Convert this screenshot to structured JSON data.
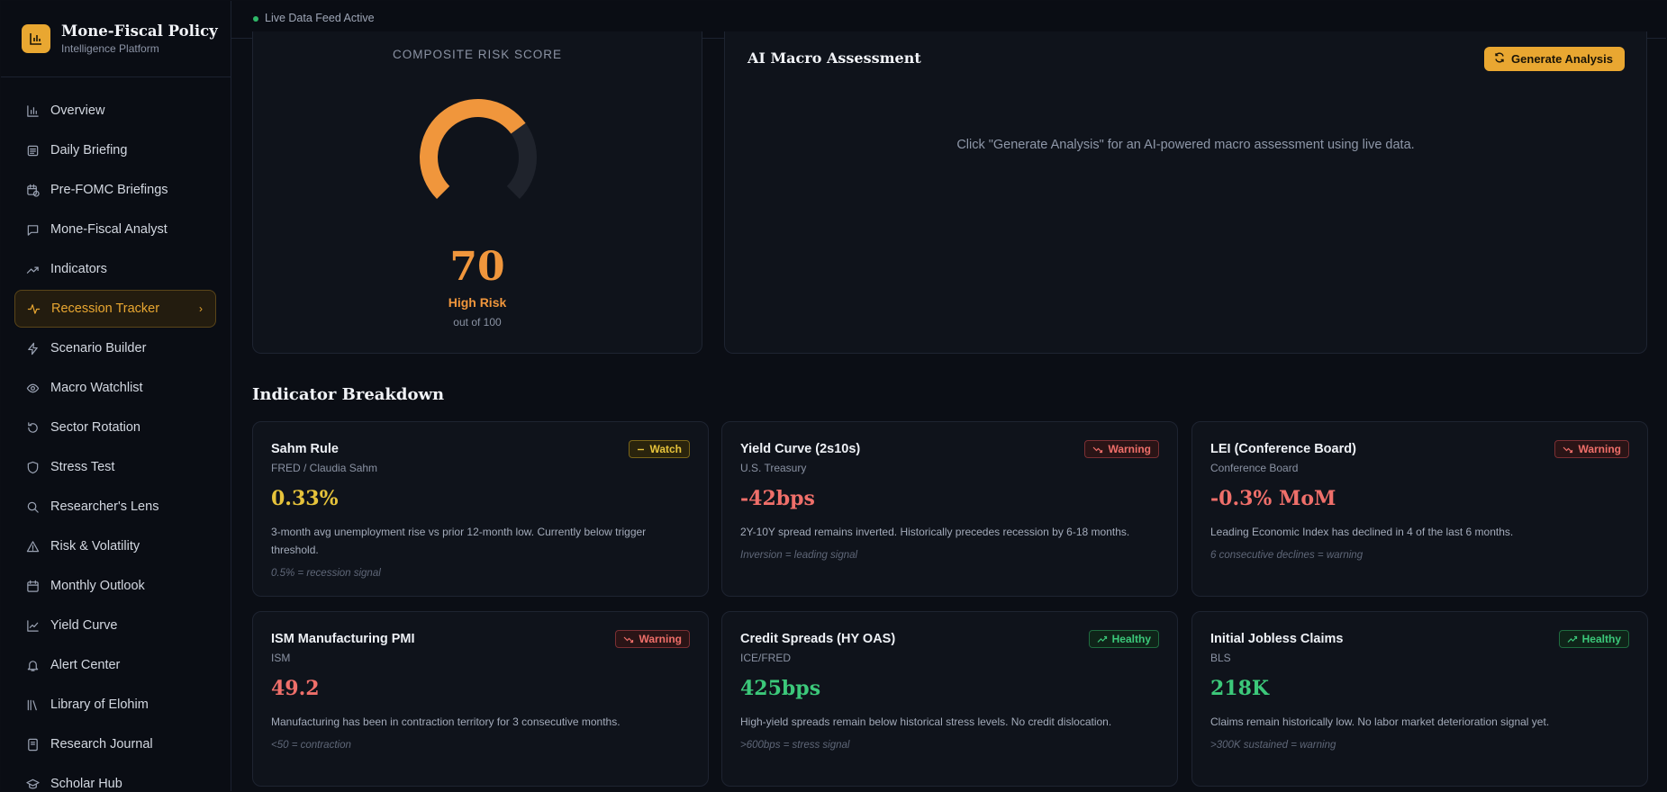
{
  "brand": {
    "title": "Mone-Fiscal Policy",
    "subtitle": "Intelligence Platform",
    "accent": "#e9a731"
  },
  "status": {
    "live_text": "Live Data Feed Active",
    "color": "#2fb868"
  },
  "sidebar": {
    "items": [
      {
        "label": "Overview",
        "icon": "bar-chart-icon"
      },
      {
        "label": "Daily Briefing",
        "icon": "newspaper-icon"
      },
      {
        "label": "Pre-FOMC Briefings",
        "icon": "calendar-clock-icon"
      },
      {
        "label": "Mone-Fiscal Analyst",
        "icon": "chat-icon"
      },
      {
        "label": "Indicators",
        "icon": "trending-up-icon"
      },
      {
        "label": "Recession Tracker",
        "icon": "activity-icon",
        "active": true
      },
      {
        "label": "Scenario Builder",
        "icon": "zap-icon"
      },
      {
        "label": "Macro Watchlist",
        "icon": "eye-icon"
      },
      {
        "label": "Sector Rotation",
        "icon": "rotate-icon"
      },
      {
        "label": "Stress Test",
        "icon": "shield-icon"
      },
      {
        "label": "Researcher's Lens",
        "icon": "search-icon"
      },
      {
        "label": "Risk & Volatility",
        "icon": "alert-triangle-icon"
      },
      {
        "label": "Monthly Outlook",
        "icon": "calendar-icon"
      },
      {
        "label": "Yield Curve",
        "icon": "line-chart-icon"
      },
      {
        "label": "Alert Center",
        "icon": "bell-icon"
      },
      {
        "label": "Library of Elohim",
        "icon": "library-icon"
      },
      {
        "label": "Research Journal",
        "icon": "notebook-icon"
      },
      {
        "label": "Scholar Hub",
        "icon": "graduation-cap-icon"
      }
    ]
  },
  "risk": {
    "label": "COMPOSITE RISK SCORE",
    "score": "70",
    "score_value": 70,
    "max": 100,
    "level": "High Risk",
    "out_of": "out of 100",
    "color": "#f0963c"
  },
  "ai": {
    "title": "AI Macro Assessment",
    "button_label": "Generate Analysis",
    "message": "Click \"Generate Analysis\" for an AI-powered macro assessment using live data."
  },
  "breakdown": {
    "title": "Indicator Breakdown",
    "cards": [
      {
        "title": "Sahm Rule",
        "source": "FRED / Claudia Sahm",
        "value": "0.33%",
        "badge": "Watch",
        "status": "watch",
        "desc": "3-month avg unemployment rise vs prior 12-month low. Currently below trigger threshold.",
        "note": "0.5% = recession signal"
      },
      {
        "title": "Yield Curve (2s10s)",
        "source": "U.S. Treasury",
        "value": "-42bps",
        "badge": "Warning",
        "status": "warning",
        "desc": "2Y-10Y spread remains inverted. Historically precedes recession by 6-18 months.",
        "note": "Inversion = leading signal"
      },
      {
        "title": "LEI (Conference Board)",
        "source": "Conference Board",
        "value": "-0.3% MoM",
        "badge": "Warning",
        "status": "warning",
        "desc": "Leading Economic Index has declined in 4 of the last 6 months.",
        "note": "6 consecutive declines = warning"
      },
      {
        "title": "ISM Manufacturing PMI",
        "source": "ISM",
        "value": "49.2",
        "badge": "Warning",
        "status": "warning",
        "desc": "Manufacturing has been in contraction territory for 3 consecutive months.",
        "note": "<50 = contraction"
      },
      {
        "title": "Credit Spreads (HY OAS)",
        "source": "ICE/FRED",
        "value": "425bps",
        "badge": "Healthy",
        "status": "healthy",
        "desc": "High-yield spreads remain below historical stress levels. No credit dislocation.",
        "note": ">600bps = stress signal"
      },
      {
        "title": "Initial Jobless Claims",
        "source": "BLS",
        "value": "218K",
        "badge": "Healthy",
        "status": "healthy",
        "desc": "Claims remain historically low. No labor market deterioration signal yet.",
        "note": ">300K sustained = warning"
      }
    ]
  }
}
